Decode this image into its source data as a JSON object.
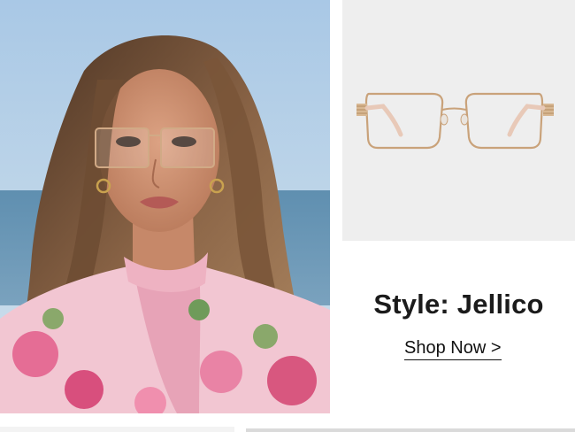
{
  "product": {
    "style_title": "Style: Jellico",
    "cta_label": "Shop Now >"
  },
  "colors": {
    "frame_gold": "#c9a27a",
    "panel_bg": "#eeeeee",
    "text": "#1b1b1b"
  },
  "images": {
    "model_photo": "model-wearing-glasses",
    "product_photo": "rectangle-gold-eyeglass-frames"
  }
}
